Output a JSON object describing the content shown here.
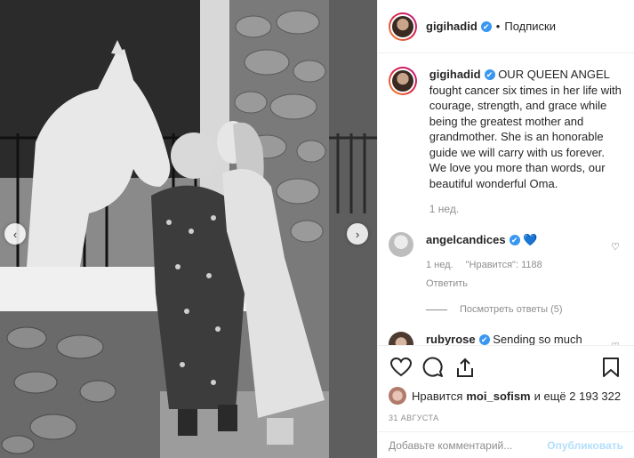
{
  "post": {
    "username": "gigihadid",
    "follow_status": "Подписки",
    "dot": "•"
  },
  "caption": {
    "username": "gigihadid",
    "text": "OUR QUEEN ANGEL fought cancer six times in her life with courage, strength, and grace while being the greatest mother and grandmother. She is an honorable guide we will carry with us forever. We love you more than words, our beautiful wonderful Oma.",
    "time": "1 нед."
  },
  "comments": [
    {
      "username": "angelcandices",
      "text": "",
      "emoji": "💙",
      "time": "1 нед.",
      "likes": "\"Нравится\": 1188",
      "reply": "Ответить",
      "view_replies": "Посмотреть ответы (5)"
    },
    {
      "username": "rubyrose",
      "text": "Sending so much love",
      "emoji": "❤️"
    }
  ],
  "likes": {
    "prefix": "Нравится",
    "user": "moi_sofism",
    "suffix": "и ещё 2 193 322"
  },
  "date": "31 АВГУСТА",
  "composer": {
    "placeholder": "Добавьте комментарий...",
    "publish": "Опубликовать"
  },
  "icons": {
    "verified": "✔",
    "prev": "‹",
    "next": "›",
    "heart_small": "♡"
  },
  "colors": {
    "verified": "#3897f0",
    "publish_disabled": "#b2dffc",
    "muted": "#8e8e8e"
  }
}
